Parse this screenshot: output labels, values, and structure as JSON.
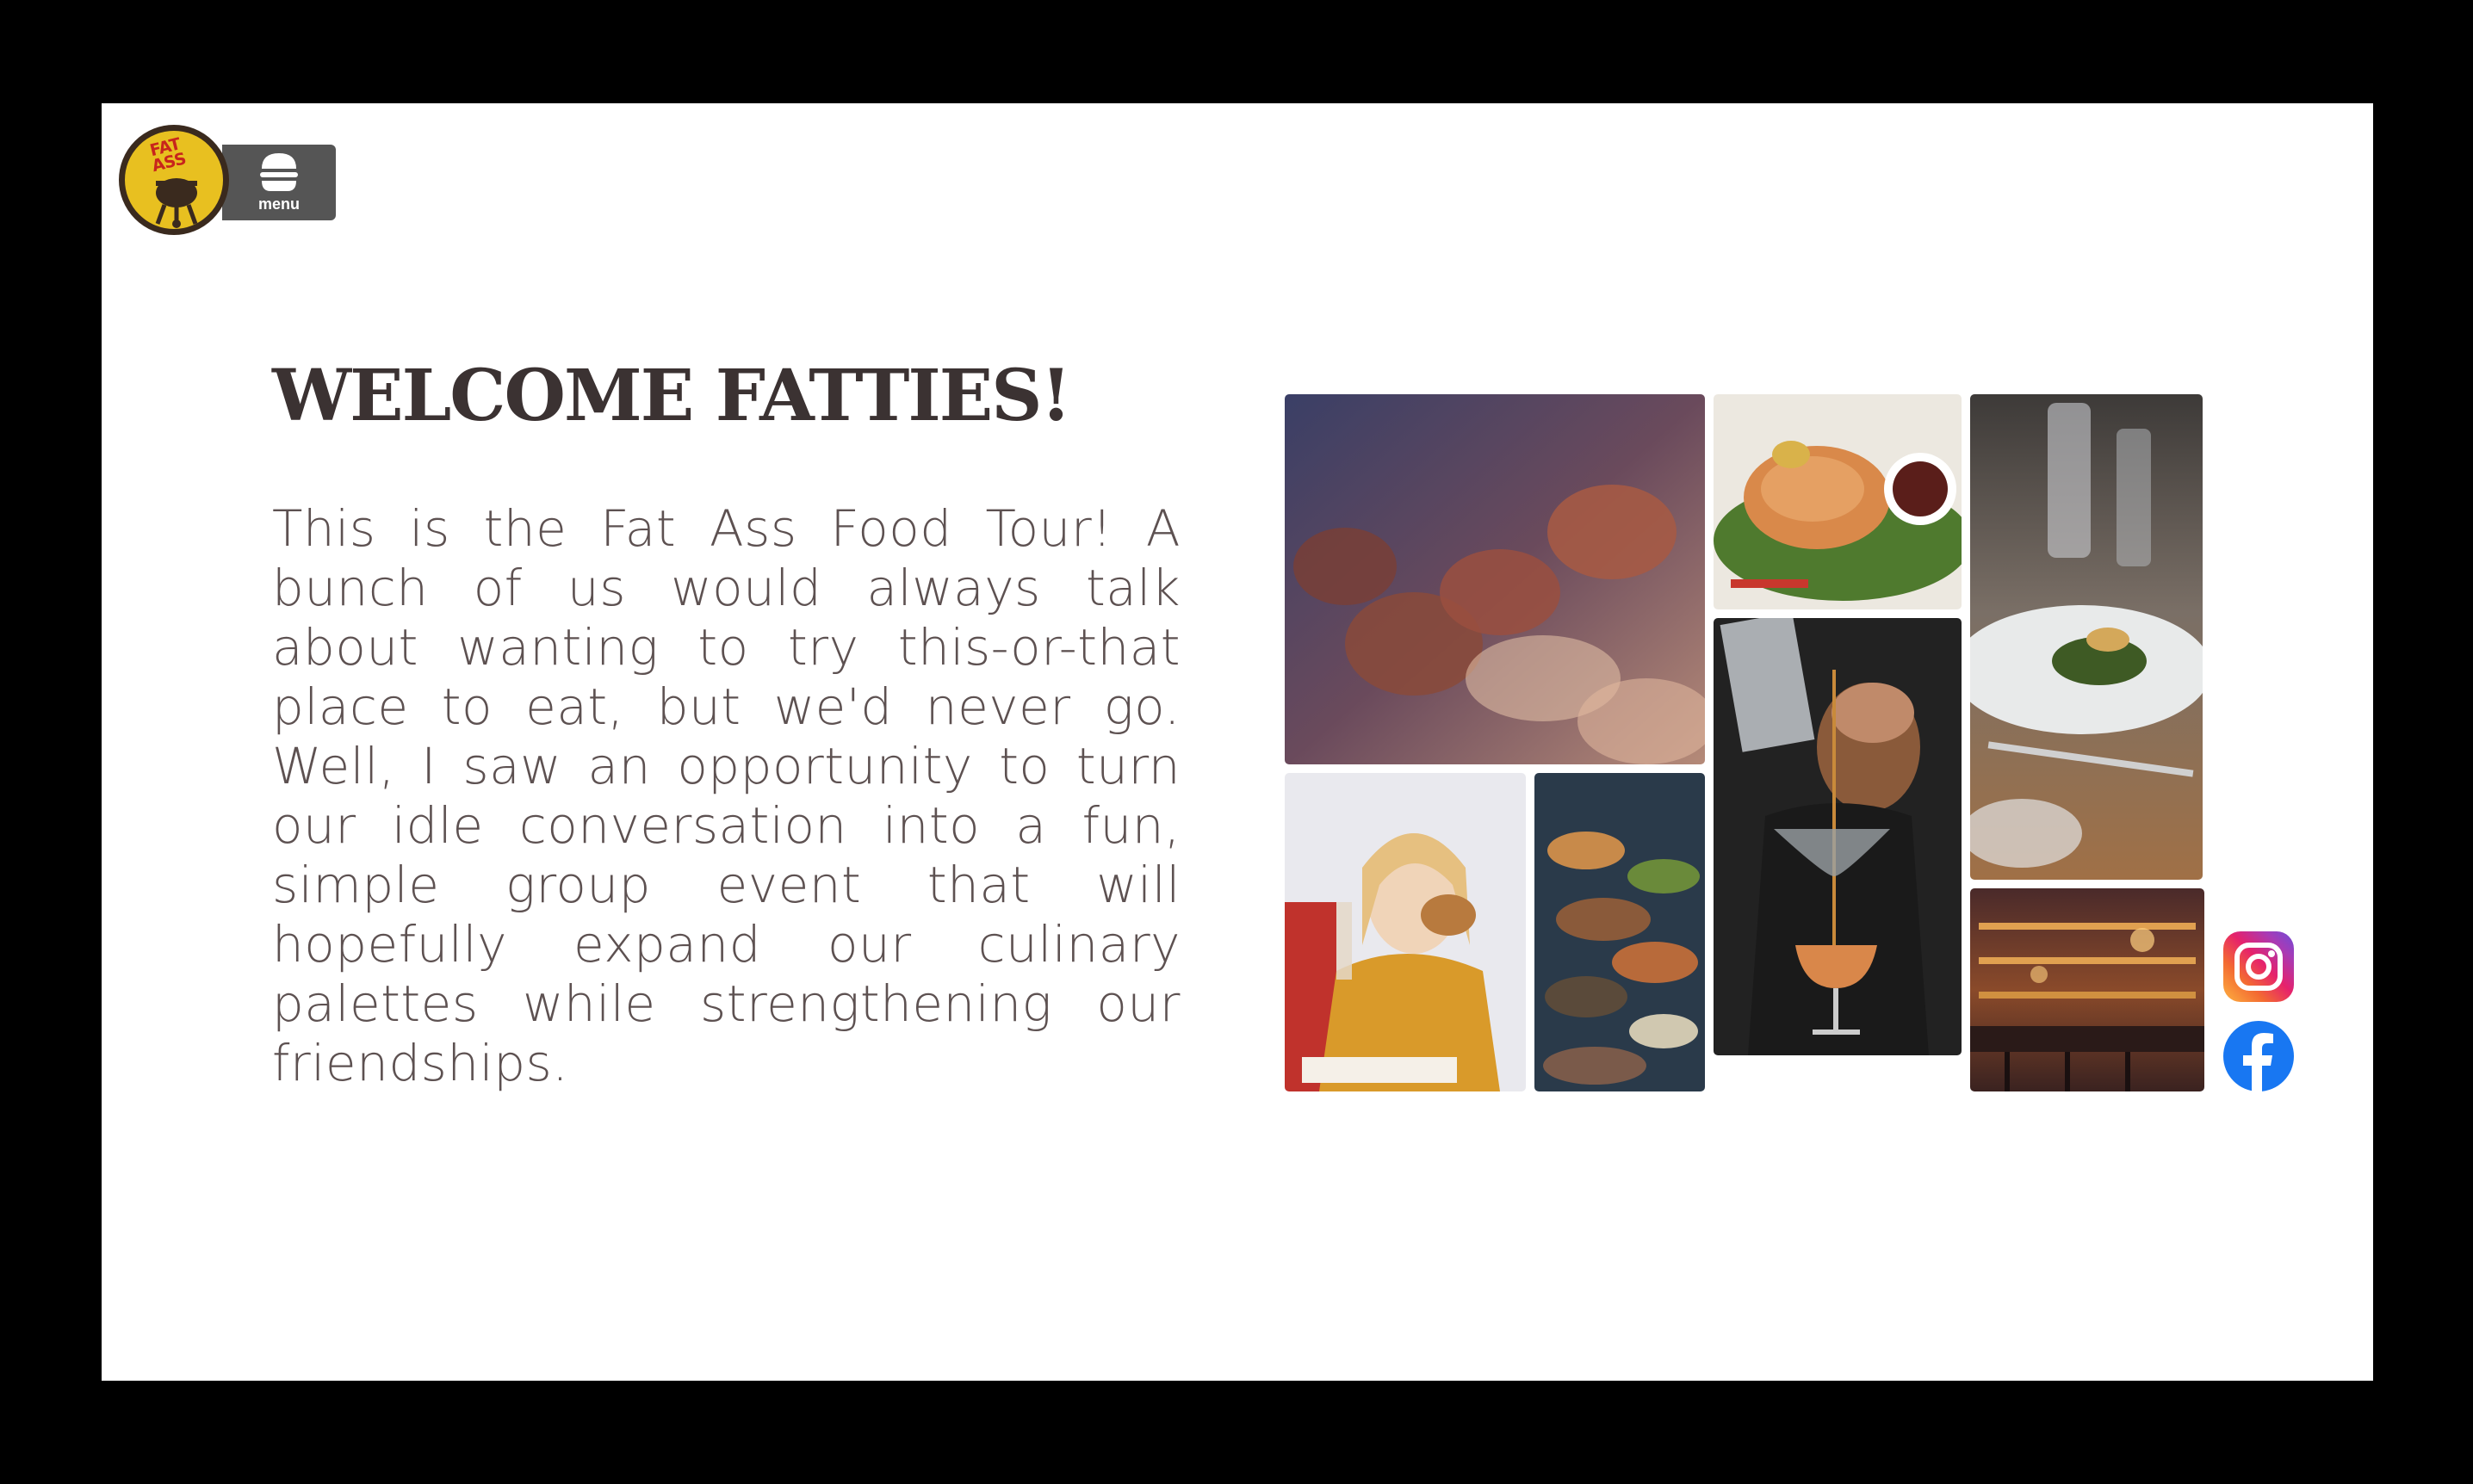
{
  "header": {
    "logo_text": "FAT ASS",
    "menu_label": "menu",
    "menu_icon": "hamburger-icon"
  },
  "main": {
    "title": "WELCOME FATTIES!",
    "body": "This is the Fat Ass Food Tour! A bunch of us would always talk about wanting to try this-or-that place to eat, but we'd never go. Well, I saw an opportunity to turn our idle conversation into a fun, simple group event that will hopefully expand our culinary palettes while strengthening our friendships."
  },
  "gallery": {
    "photos": [
      "wine-glasses-toast-photo",
      "salmon-salad-photo",
      "restaurant-plated-dish-photo",
      "bartender-cocktail-photo",
      "woman-eating-burger-photo",
      "buffet-table-photo",
      "bar-interior-photo"
    ]
  },
  "social": {
    "icons": [
      "instagram-icon",
      "facebook-icon"
    ]
  },
  "colors": {
    "title": "#3b3232",
    "body": "#5d5151",
    "logo_yellow": "#e8c020",
    "logo_red": "#c8251c",
    "menu_bg": "#555555",
    "facebook_blue": "#1877f2"
  }
}
